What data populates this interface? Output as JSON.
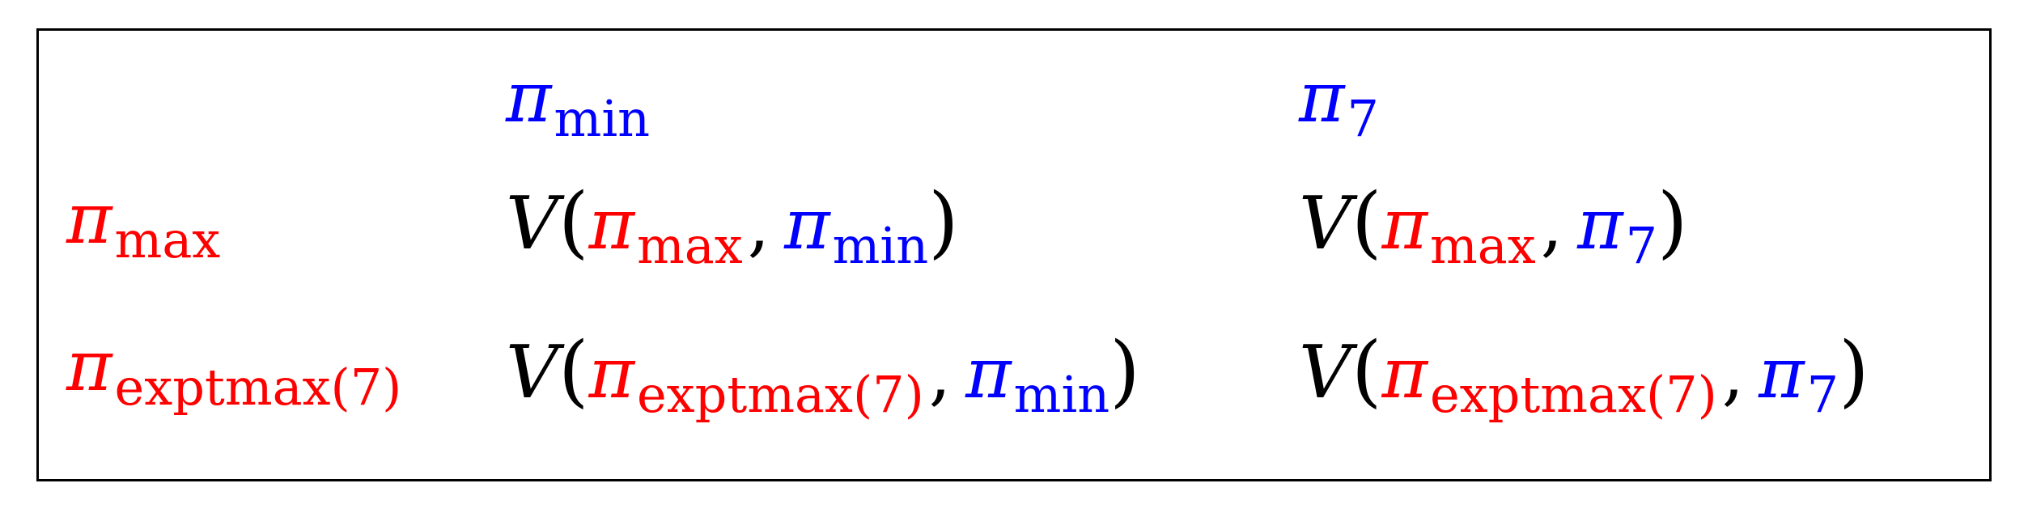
{
  "colors": {
    "row_player": "#ff0000",
    "col_player": "#0000ff",
    "text": "#000000",
    "border": "#000000"
  },
  "symbols": {
    "pi": "π",
    "value_fn": "V",
    "open_paren": "(",
    "close_paren": ")",
    "comma": ","
  },
  "columns": [
    {
      "sub": "min"
    },
    {
      "sub": "7"
    }
  ],
  "rows": [
    {
      "sub": "max"
    },
    {
      "sub": "exptmax(7)"
    }
  ]
}
